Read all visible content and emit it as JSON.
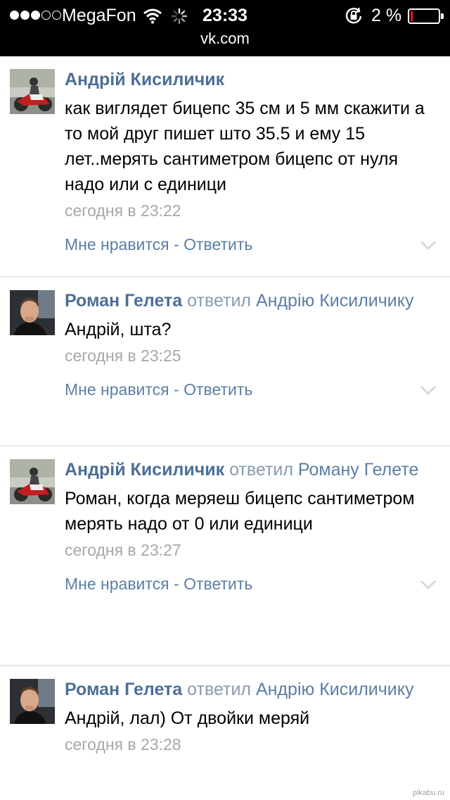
{
  "status_bar": {
    "signal_filled": 3,
    "signal_total": 5,
    "carrier": "MegaFon",
    "time": "23:33",
    "battery_pct": "2 %",
    "url": "vk.com",
    "battery_color": "#e8141d"
  },
  "comments": [
    {
      "author": "Андрій Кисиличик",
      "reply_word": "",
      "reply_target": "",
      "text": "как виглядет бицепс 35 см и 5 мм скажити а то мой друг пишет што 35.5 и ему 15 лет..мерять сантиметром бицепс от нуля надо или с единици",
      "time": "сегодня в 23:22",
      "like": "Мне нравится",
      "sep": " - ",
      "reply": "Ответить",
      "avatar": "motorbike-rider"
    },
    {
      "author": "Роман Гелета",
      "reply_word": "ответил",
      "reply_target": "Андрію Кисиличику",
      "text": "Андрій, шта?",
      "time": "сегодня в 23:25",
      "like": "Мне нравится",
      "sep": " - ",
      "reply": "Ответить",
      "avatar": "young-man"
    },
    {
      "author": "Андрій Кисиличик",
      "reply_word": "ответил",
      "reply_target": "Роману Гелете",
      "text": "Роман, когда меряеш бицепс сантиметром мерять надо от 0 или единици",
      "time": "сегодня в 23:27",
      "like": "Мне нравится",
      "sep": " - ",
      "reply": "Ответить",
      "avatar": "motorbike-rider"
    },
    {
      "author": "Роман Гелета",
      "reply_word": "ответил",
      "reply_target": "Андрію Кисиличику",
      "text": "Андрій, лал) От двойки меряй",
      "time": "сегодня в 23:28",
      "like": "",
      "sep": "",
      "reply": "",
      "avatar": "young-man"
    }
  ],
  "watermark": "pikabu.ru",
  "colors": {
    "link": "#4c6f97",
    "meta": "#a4a7ab",
    "divider": "#e4e6e9"
  }
}
